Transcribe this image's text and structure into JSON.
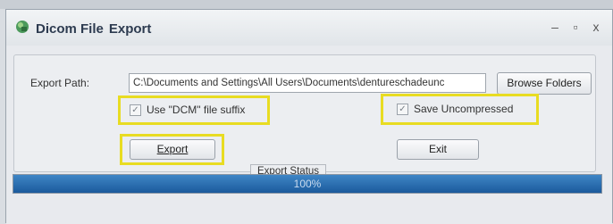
{
  "window": {
    "title_word1": "Dicom File",
    "title_word2": "Export",
    "minimize": "–",
    "maximize": "▫",
    "close": "x"
  },
  "form": {
    "path_label": "Export Path:",
    "path_value": "C:\\Documents and Settings\\All Users\\Documents\\dentureschadeunc",
    "browse_label": "Browse Folders",
    "dcm_suffix_label": "Use \"DCM\" file suffix",
    "dcm_suffix_checked": true,
    "save_uncompressed_label": "Save Uncompressed",
    "save_uncompressed_checked": true,
    "export_label": "Export",
    "exit_label": "Exit"
  },
  "status": {
    "legend": "Export Status",
    "progress_text": "100%",
    "progress_fraction": 1.0
  },
  "colors": {
    "highlight": "#e8dc22",
    "progress_fill": "#1b5a9c"
  },
  "icons": {
    "app": "dicom-app-icon",
    "check": "checkmark"
  }
}
